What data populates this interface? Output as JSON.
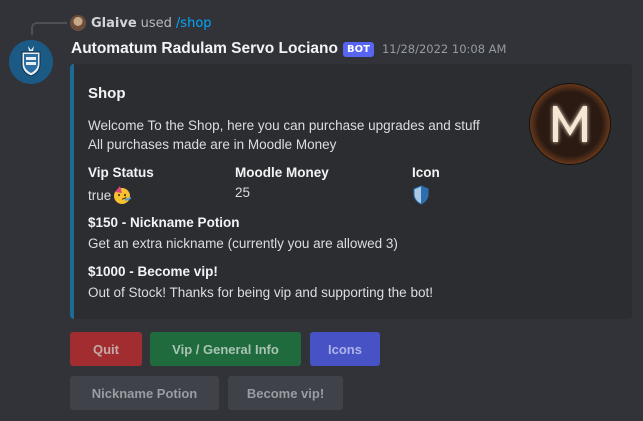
{
  "reply": {
    "username": "Glaive",
    "used_text": "used",
    "command": "/shop"
  },
  "message": {
    "author": "Automatum Radulam Servo Lociano",
    "bot_tag": "BOT",
    "timestamp": "11/28/2022 10:08 AM"
  },
  "embed": {
    "accent_color": "#1e6a96",
    "title": "Shop",
    "description_lines": [
      "Welcome To the Shop, here you can purchase upgrades and stuff",
      "All purchases made are in Moodle Money"
    ],
    "thumbnail_letter": "M",
    "fields": [
      {
        "name": "Vip Status",
        "value": "true",
        "emoji": "party-face"
      },
      {
        "name": "Moodle Money",
        "value": "25"
      },
      {
        "name": "Icon",
        "value": "",
        "emoji": "shield-icon"
      }
    ],
    "sections": [
      {
        "name": "$150 - Nickname Potion",
        "value": "Get an extra nickname (currently you are allowed 3)"
      },
      {
        "name": "$1000 - Become vip!",
        "value": "Out of Stock! Thanks for being vip and supporting the bot!"
      }
    ]
  },
  "buttons": {
    "row1": [
      {
        "label": "Quit",
        "style": "danger"
      },
      {
        "label": "Vip / General Info",
        "style": "success"
      },
      {
        "label": "Icons",
        "style": "primary"
      }
    ],
    "row2": [
      {
        "label": "Nickname Potion",
        "style": "secondary"
      },
      {
        "label": "Become vip!",
        "style": "secondary"
      }
    ]
  }
}
